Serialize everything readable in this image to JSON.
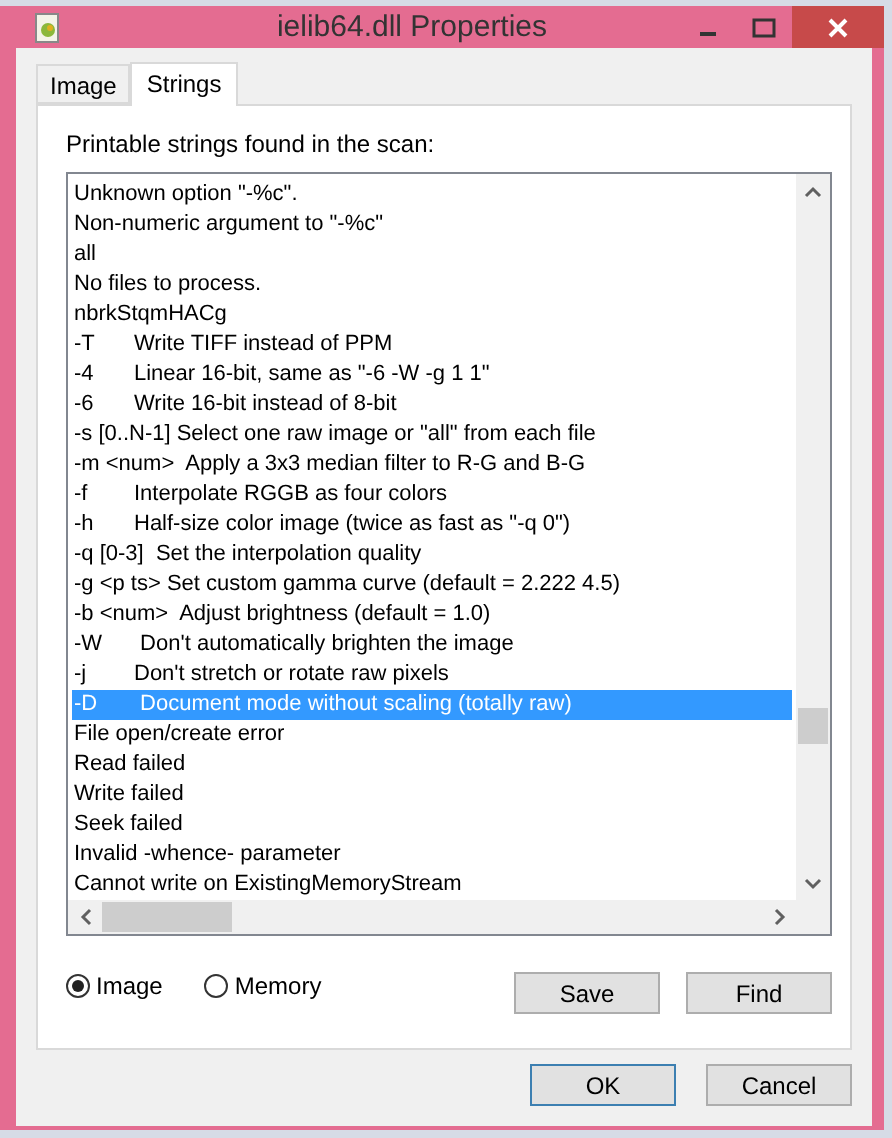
{
  "window": {
    "title": "ielib64.dll Properties"
  },
  "tabs": [
    {
      "label": "Image",
      "selected": false
    },
    {
      "label": "Strings",
      "selected": true
    }
  ],
  "caption": "Printable strings found in the scan:",
  "strings": [
    {
      "text": "Unknown option \"-%c\".",
      "selected": false
    },
    {
      "text": "Non-numeric argument to \"-%c\"",
      "selected": false
    },
    {
      "text": "all",
      "selected": false
    },
    {
      "text": "No files to process.",
      "selected": false
    },
    {
      "text": "nbrkStqmHACg",
      "selected": false
    },
    {
      "text": "-T\tWrite TIFF instead of PPM",
      "selected": false
    },
    {
      "text": "-4\tLinear 16-bit, same as \"-6 -W -g 1 1\"",
      "selected": false
    },
    {
      "text": "-6\tWrite 16-bit instead of 8-bit",
      "selected": false
    },
    {
      "text": "-s [0..N-1] Select one raw image or \"all\" from each file",
      "selected": false
    },
    {
      "text": "-m <num>  Apply a 3x3 median filter to R-G and B-G",
      "selected": false
    },
    {
      "text": "-f\tInterpolate RGGB as four colors",
      "selected": false
    },
    {
      "text": "-h\tHalf-size color image (twice as fast as \"-q 0\")",
      "selected": false
    },
    {
      "text": "-q [0-3]  Set the interpolation quality",
      "selected": false
    },
    {
      "text": "-g <p ts> Set custom gamma curve (default = 2.222 4.5)",
      "selected": false
    },
    {
      "text": "-b <num>  Adjust brightness (default = 1.0)",
      "selected": false
    },
    {
      "text": "-W\t Don't automatically brighten the image",
      "selected": false
    },
    {
      "text": "-j\tDon't stretch or rotate raw pixels",
      "selected": false
    },
    {
      "text": "-D\t Document mode without scaling (totally raw)",
      "selected": true
    },
    {
      "text": "File open/create error",
      "selected": false
    },
    {
      "text": "Read failed",
      "selected": false
    },
    {
      "text": "Write failed",
      "selected": false
    },
    {
      "text": "Seek failed",
      "selected": false
    },
    {
      "text": "Invalid -whence- parameter",
      "selected": false
    },
    {
      "text": "Cannot write on ExistingMemoryStream",
      "selected": false
    }
  ],
  "sources": [
    {
      "label": "Image",
      "selected": true
    },
    {
      "label": "Memory",
      "selected": false
    }
  ],
  "panel_buttons": [
    "Save",
    "Find"
  ],
  "dialog_buttons": [
    {
      "label": "OK",
      "selected": true
    },
    {
      "label": "Cancel",
      "selected": false
    }
  ]
}
